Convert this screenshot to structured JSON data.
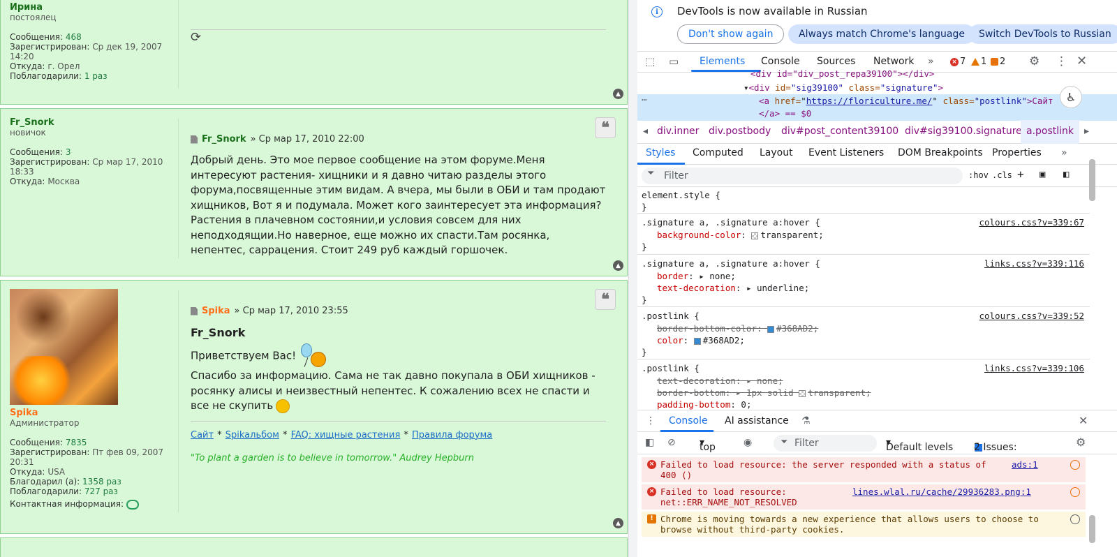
{
  "forum": {
    "posts": [
      {
        "user": {
          "name": "Ирина",
          "rank": "постоялец",
          "posts_label": "Сообщения:",
          "posts": "468",
          "reg_label": "Зарегистрирован:",
          "reg": "Ср дек 19, 2007 14:20",
          "from_label": "Откуда:",
          "from": "г. Орел",
          "thanked_label": "Поблагодарили:",
          "thanked": "1 раз"
        }
      },
      {
        "user": {
          "name": "Fr_Snork",
          "rank": "новичок",
          "posts_label": "Сообщения:",
          "posts": "3",
          "reg_label": "Зарегистрирован:",
          "reg": "Ср мар 17, 2010 18:33",
          "from_label": "Откуда:",
          "from": "Москва"
        },
        "author": "Fr_Snork",
        "date": "» Ср мар 17, 2010 22:00",
        "text": "Добрый день. Это мое первое сообщение на этом форуме.Меня интересуют растения- хищники и я давно читаю разделы этого форума,посвященные этим видам. А вчера, мы были в ОБИ и там продают хищников, Вот я и подумала. Может кого заинтересует эта информация? Растения в плачевном состоянии,и условия совсем для них неподходящии.Но наверное, еще можно их спасти.Там росянка, непентес, саррацения. Стоит 249 руб каждый горшочек."
      },
      {
        "user": {
          "name": "Spika",
          "rank": "Администратор",
          "posts_label": "Сообщения:",
          "posts": "7835",
          "reg_label": "Зарегистрирован:",
          "reg": "Пт фев 09, 2007 20:31",
          "from_label": "Откуда:",
          "from": "USA",
          "thanks_label": "Благодарил (а):",
          "thanks": "1358 раз",
          "thanked_label": "Поблагодарили:",
          "thanked": "727 раз",
          "contact_label": "Контактная информация:"
        },
        "author": "Spika",
        "date": "» Ср мар 17, 2010 23:55",
        "quote_name": "Fr_Snork",
        "greet": "Приветствуем Вас!",
        "text": "Спасибо за информацию. Сама не так давно покупала в ОБИ хищников - росянку алисы и неизвестный непентес. К сожалению всех не спасти и все не скупить",
        "sig_links": [
          "Сайт",
          "Spikaльбом",
          "FAQ: хищные растения",
          "Правила форума"
        ],
        "sig_sep": "*",
        "sig_quote": "\"To plant a garden is to believe in tomorrow.\" Audrey Hepburn"
      }
    ]
  },
  "devtools": {
    "infobar": {
      "text": "DevTools is now available in Russian",
      "btn_dont_show": "Don't show again",
      "btn_match": "Always match Chrome's language",
      "btn_switch": "Switch DevTools to Russian"
    },
    "tabs": [
      "Elements",
      "Console",
      "Sources",
      "Network"
    ],
    "more": "»",
    "errors": "7",
    "warnings": "1",
    "issues": "2",
    "dom": {
      "line0": "<div id=\"div_post_repa39100\"></div>",
      "line1_tag": "<div",
      "line1_attr_id": "id=",
      "line1_id": "\"sig39100\"",
      "line1_attr_class": "class=",
      "line1_class": "\"signature\"",
      "line2_tag": "<a",
      "line2_attr_href": "href=",
      "line2_href": "https://floriculture.me/",
      "line2_attr_class": "class=",
      "line2_class": "\"postlink\"",
      "line2_text": ">Сайт",
      "line3": "</a> == $0"
    },
    "breadcrumbs": [
      "div.inner",
      "div.postbody",
      "div#post_content39100",
      "div#sig39100.signature",
      "a.postlink"
    ],
    "subtabs": [
      "Styles",
      "Computed",
      "Layout",
      "Event Listeners",
      "DOM Breakpoints",
      "Properties"
    ],
    "filter_placeholder": "Filter",
    "hov": ":hov",
    "cls": ".cls",
    "rules": [
      {
        "selector": "element.style {",
        "close": "}"
      },
      {
        "selector": ".signature a, .signature a:hover {",
        "src": "colours.css?v=339:67",
        "p1": "background-color",
        "v1": "transparent;",
        "close": "}"
      },
      {
        "selector": ".signature a, .signature a:hover {",
        "src": "links.css?v=339:116",
        "p1": "border",
        "v1": "none;",
        "p2": "text-decoration",
        "v2": "underline;",
        "close": "}"
      },
      {
        "selector": ".postlink {",
        "src": "colours.css?v=339:52",
        "p1": "border-bottom-color",
        "v1": "#368AD2;",
        "p2": "color",
        "v2": "#368AD2;",
        "close": "}"
      },
      {
        "selector": ".postlink {",
        "src": "links.css?v=339:106",
        "p1": "text-decoration",
        "v1": "none;",
        "p2": "border-bottom",
        "v2": "1px solid",
        "v2b": "transparent;",
        "p3": "padding-bottom",
        "v3": "0;"
      }
    ],
    "drawer": {
      "tab_console": "Console",
      "tab_ai": "AI assistance",
      "context": "top",
      "filter": "Filter",
      "levels": "Default levels",
      "issues_label": "4 Issues:",
      "issues_a": "2",
      "issues_b": "2",
      "messages": [
        {
          "type": "error",
          "text": "Failed to load resource: the server responded with a status of 400 ()",
          "link": "ads:1"
        },
        {
          "type": "error",
          "text": "Failed to load resource: net::ERR_NAME_NOT_RESOLVED",
          "link": "lines.wlal.ru/cache/29936283.png:1"
        },
        {
          "type": "warning",
          "text": "Chrome is moving towards a new experience that allows users to choose to browse without third-party cookies."
        }
      ]
    },
    "colors": {
      "accent": "#1a73e8",
      "link": "#368AD2",
      "error": "#d93025",
      "warning": "#e37400"
    }
  }
}
